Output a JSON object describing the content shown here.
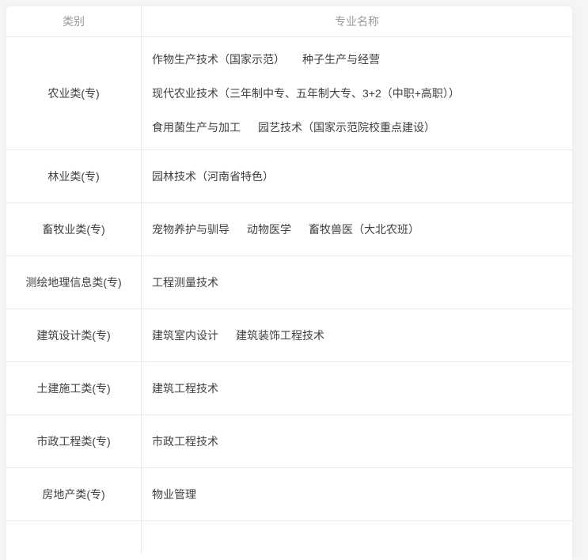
{
  "colors": {
    "page_background": "#f5f5f5",
    "card_background": "#ffffff",
    "border": "#e9e9e9",
    "header_text": "#9c9c9c",
    "body_text": "#404040"
  },
  "table": {
    "columns": [
      {
        "label": "类别"
      },
      {
        "label": "专业名称"
      }
    ],
    "rows": [
      {
        "category": "农业类(专)",
        "major_lines": [
          [
            "作物生产技术（国家示范）",
            "种子生产与经营"
          ],
          [
            "现代农业技术（三年制中专、五年制大专、3+2（中职+高职））"
          ],
          [
            "食用菌生产与加工",
            "园艺技术（国家示范院校重点建设）"
          ]
        ]
      },
      {
        "category": "林业类(专)",
        "major_lines": [
          [
            "园林技术（河南省特色）"
          ]
        ]
      },
      {
        "category": "畜牧业类(专)",
        "major_lines": [
          [
            "宠物养护与驯导",
            "动物医学",
            "畜牧兽医（大北农班）"
          ]
        ]
      },
      {
        "category": "测绘地理信息类(专)",
        "major_lines": [
          [
            "工程测量技术"
          ]
        ]
      },
      {
        "category": "建筑设计类(专)",
        "major_lines": [
          [
            "建筑室内设计",
            "建筑装饰工程技术"
          ]
        ]
      },
      {
        "category": "土建施工类(专)",
        "major_lines": [
          [
            "建筑工程技术"
          ]
        ]
      },
      {
        "category": "市政工程类(专)",
        "major_lines": [
          [
            "市政工程技术"
          ]
        ]
      },
      {
        "category": "房地产类(专)",
        "major_lines": [
          [
            "物业管理"
          ]
        ]
      }
    ]
  }
}
